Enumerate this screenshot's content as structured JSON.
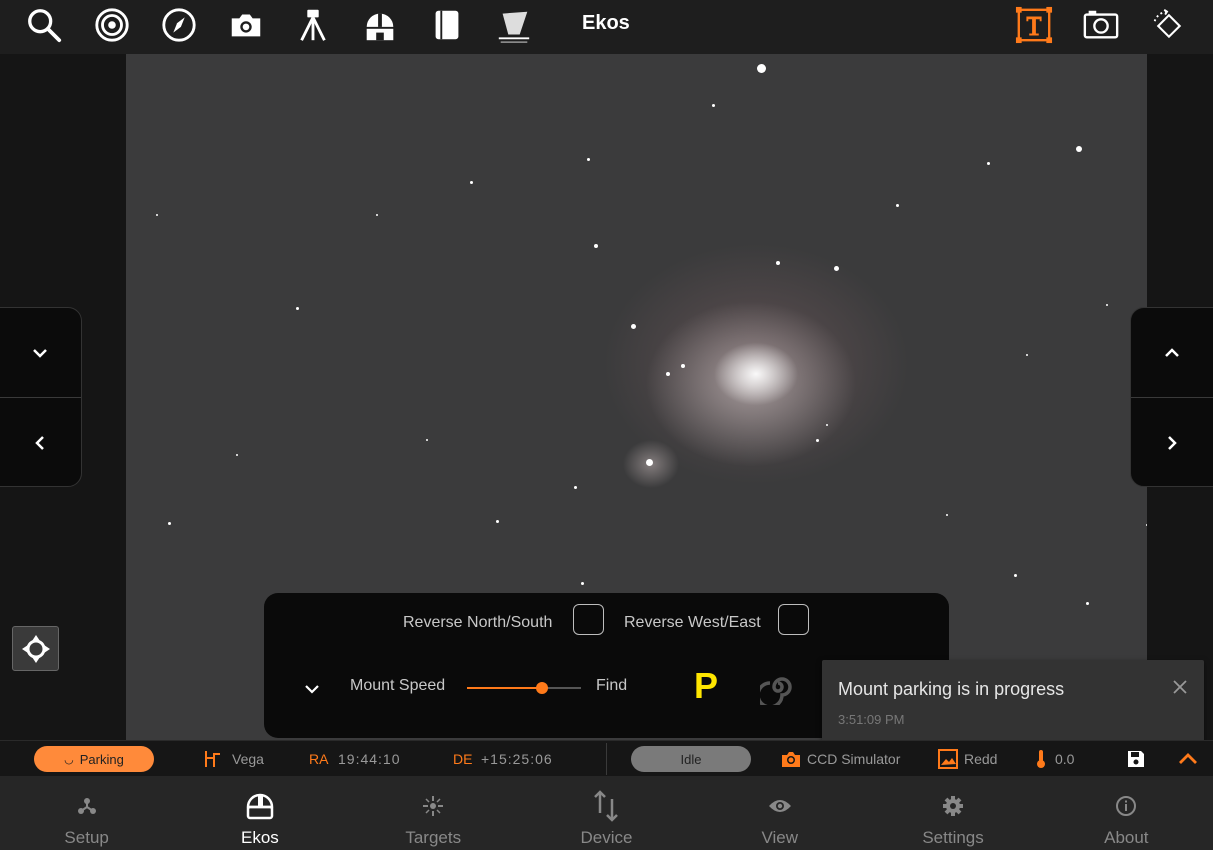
{
  "toolbar": {
    "title": "Ekos",
    "icons": [
      "search-icon",
      "target-icon",
      "compass-icon",
      "camera-icon",
      "tripod-icon",
      "observatory-icon",
      "notebook-icon",
      "telescope-view-icon",
      "text-overlay-icon",
      "snapshot-icon",
      "rotate-icon"
    ]
  },
  "mount_panel": {
    "reverse_ns_label": "Reverse North/South",
    "reverse_we_label": "Reverse West/East",
    "speed_label": "Mount Speed",
    "speed_value": "Find",
    "speed_fraction": 0.66,
    "park_label": "P"
  },
  "toast": {
    "message": "Mount parking is in progress",
    "time": "3:51:09 PM"
  },
  "status_bar": {
    "mount_status": "Parking",
    "target": "Vega",
    "ra_label": "RA",
    "ra_value": "19:44:10",
    "de_label": "DE",
    "de_value": "+15:25:06",
    "capture_status": "Idle",
    "camera": "CCD Simulator",
    "filter": "Redd",
    "temperature": "0.0"
  },
  "bottom_nav": [
    {
      "label": "Setup",
      "icon": "setup-icon"
    },
    {
      "label": "Ekos",
      "icon": "ekos-dome-icon",
      "active": true
    },
    {
      "label": "Targets",
      "icon": "targets-icon"
    },
    {
      "label": "Device",
      "icon": "device-icon"
    },
    {
      "label": "View",
      "icon": "view-eye-icon"
    },
    {
      "label": "Settings",
      "icon": "settings-gear-icon"
    },
    {
      "label": "About",
      "icon": "about-info-icon"
    }
  ],
  "colors": {
    "accent": "#ff7a1a",
    "park_yellow": "#ffe600"
  }
}
